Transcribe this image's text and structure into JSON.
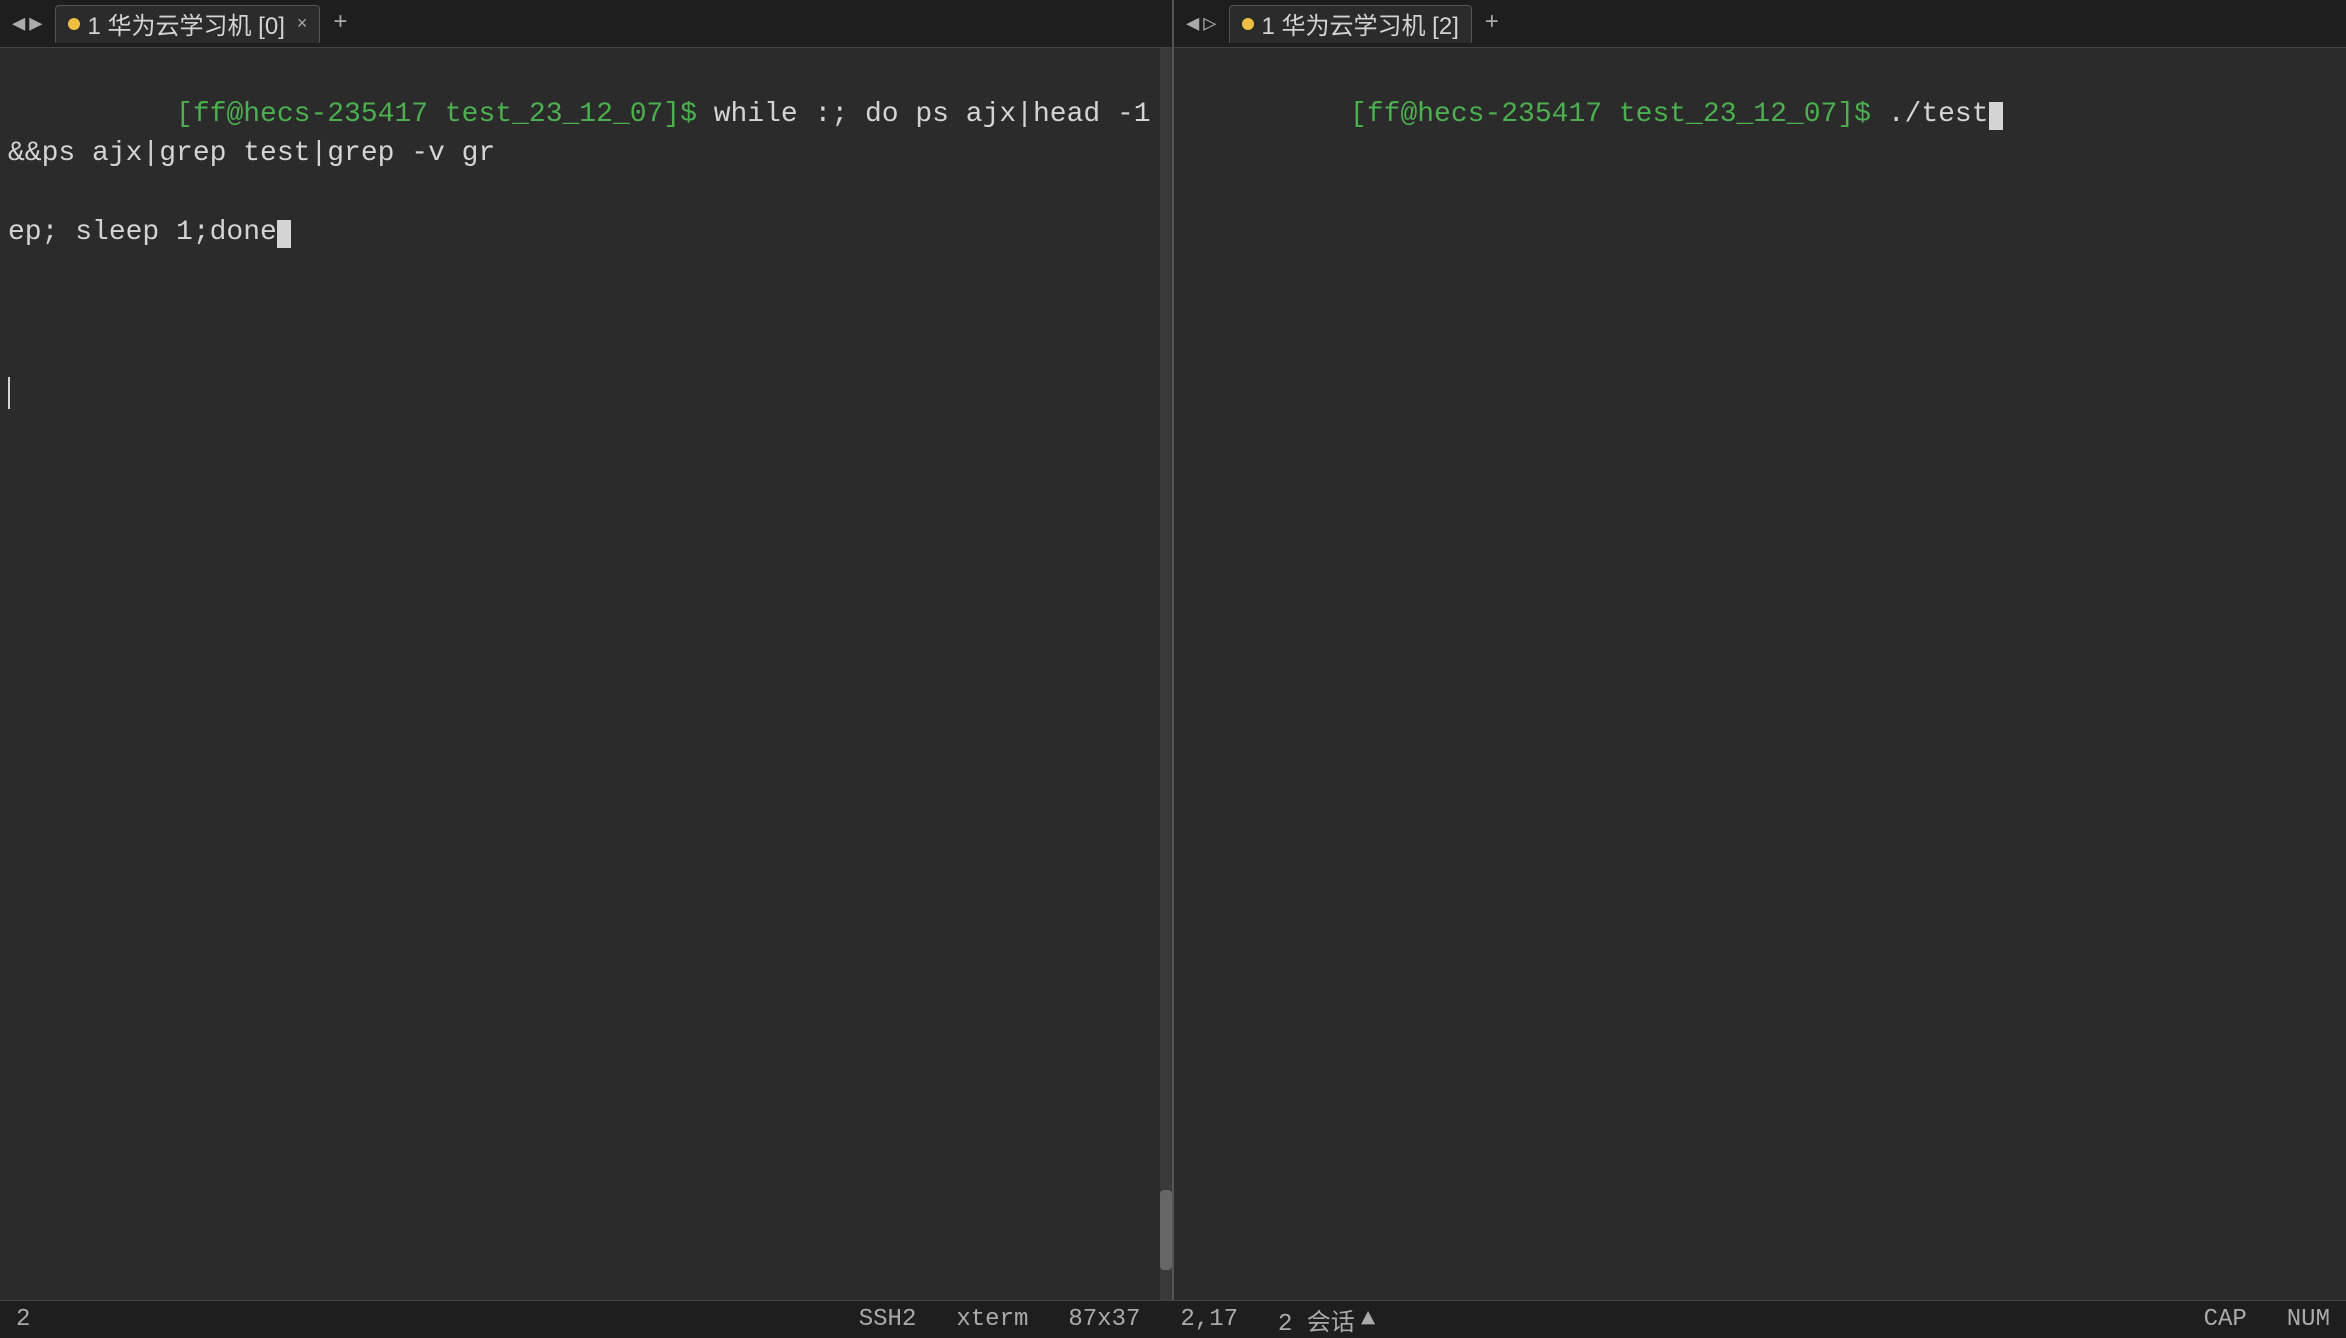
{
  "tabs": {
    "left": {
      "tab1": {
        "dot_color": "yellow",
        "label": "1 华为云学习机 [0]",
        "close": "×",
        "active": true
      },
      "add": "+"
    },
    "nav_arrows": [
      "◀",
      "▶"
    ],
    "right": {
      "tab1": {
        "dot_color": "yellow",
        "label": "1 华为云学习机 [2]",
        "close": "",
        "active": true
      },
      "add": "+"
    },
    "right_nav_arrows": [
      "◀",
      "▷"
    ]
  },
  "pane_left": {
    "prompt": "[ff@hecs-235417 test_23_12_07]$",
    "command": " while :; do ps ajx|head -1&&ps ajx|grep test|grep -v grep; sleep 1;done",
    "cursor_line": 2
  },
  "pane_right": {
    "prompt": "[ff@hecs-235417 test_23_12_07]$",
    "command": " ./test",
    "cursor_visible": true
  },
  "status_bar": {
    "page_num": "2",
    "ssh_label": "SSH2",
    "xterm_label": "xterm",
    "dimensions": "87x37",
    "position": "2,17",
    "sessions_label": "2 会话",
    "up_arrow": "▲",
    "cap_label": "CAP",
    "num_label": "NUM"
  }
}
